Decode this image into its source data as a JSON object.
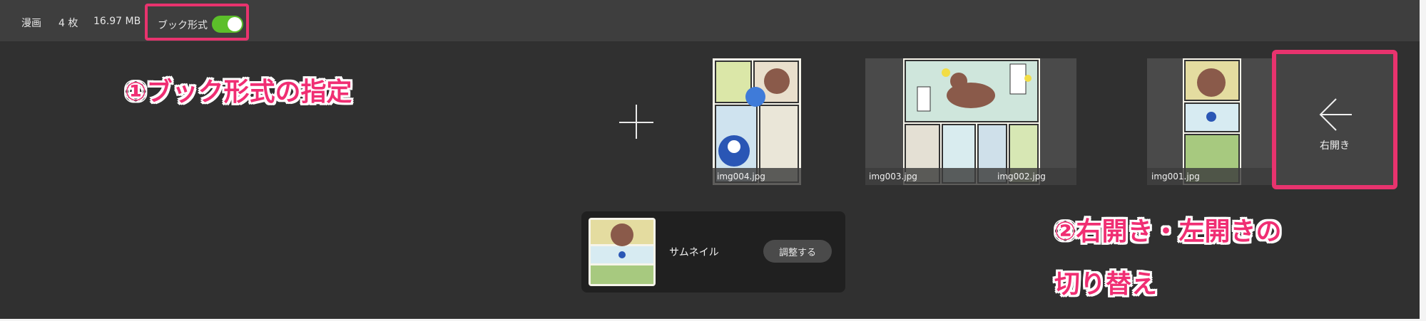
{
  "topbar": {
    "category": "漫画",
    "count": "4 枚",
    "size": "16.97 MB",
    "book_format_label": "ブック形式",
    "book_format_on": true
  },
  "annotations": {
    "book_format": "①ブック形式の指定",
    "direction_line1": "②右開き・左開きの",
    "direction_line2": "切り替え"
  },
  "pages": [
    {
      "filename": "img004.jpg"
    },
    {
      "filename": "img003.jpg"
    },
    {
      "filename": "img002.jpg"
    },
    {
      "filename": "img001.jpg"
    }
  ],
  "direction": {
    "label": "右開き",
    "icon": "arrow-left-icon"
  },
  "thumbnail": {
    "label": "サムネイル",
    "adjust_button": "調整する"
  },
  "colors": {
    "accent": "#e8336e",
    "annotation_text": "#f02e73",
    "toggle_on": "#5cbf2a",
    "background": "#303030"
  }
}
